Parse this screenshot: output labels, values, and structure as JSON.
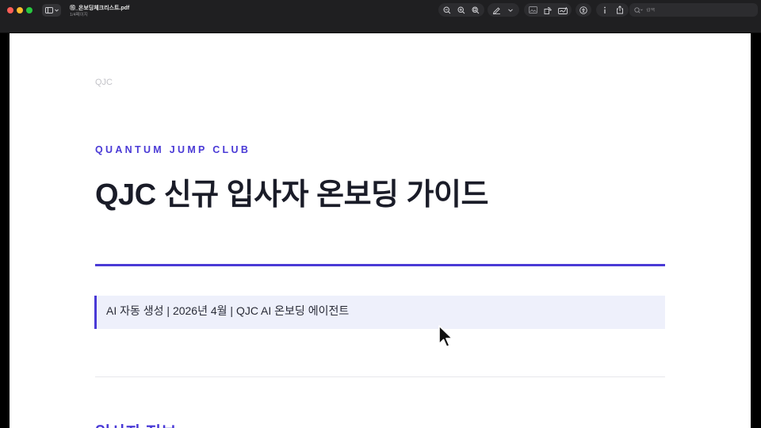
{
  "window": {
    "doc_title": "⑮_온보딩체크리스트.pdf",
    "page_count": "1/4페이지"
  },
  "toolbar": {
    "icons": [
      "sidebar-icon",
      "zoom-out-icon",
      "zoom-in-icon",
      "zoom-fit-icon",
      "markup-pen-icon",
      "chevron-down-icon",
      "image-icon",
      "rotate-icon",
      "sign-icon",
      "accessibility-icon",
      "info-icon",
      "share-icon"
    ],
    "search_placeholder": "검색"
  },
  "document": {
    "header_mark": "QJC",
    "eyebrow": "QUANTUM JUMP CLUB",
    "title": "QJC 신규 입사자 온보딩 가이드",
    "meta": "AI 자동 생성 | 2026년 4월 | QJC AI 온보딩 에이전트",
    "section_heading": "입사자 정보"
  },
  "colors": {
    "accent": "#4a3ad6",
    "title_text": "#1a1c28",
    "meta_bg": "#eef0fb",
    "toolbar_bg": "#1f1f21"
  }
}
